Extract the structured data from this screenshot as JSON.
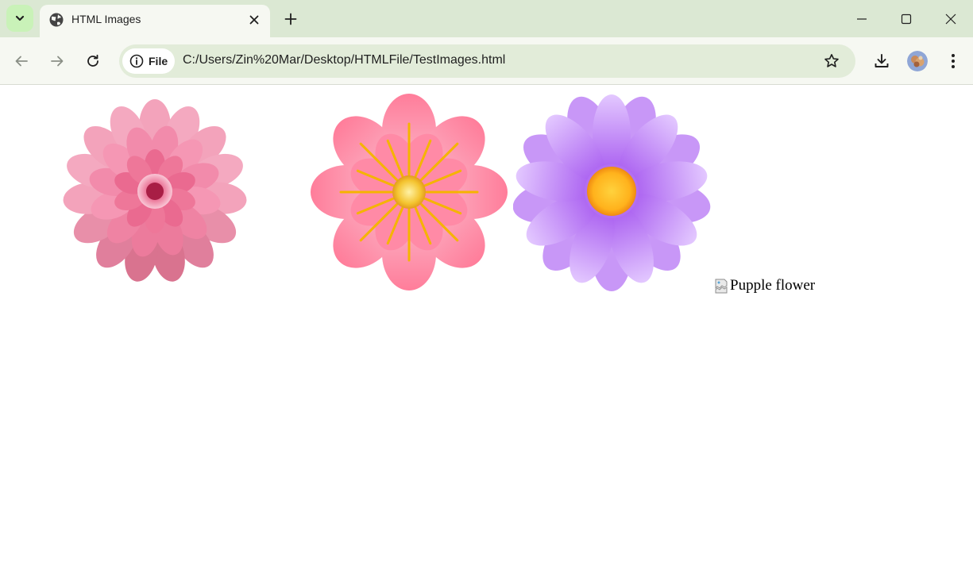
{
  "browser": {
    "tab": {
      "title": "HTML Images"
    },
    "address": {
      "security_chip": "File",
      "url": "C:/Users/Zin%20Mar/Desktop/HTMLFile/TestImages.html"
    }
  },
  "page": {
    "images": [
      {
        "description_icon": "pink-dahlia-flower"
      },
      {
        "description_icon": "pink-cartoon-flower"
      },
      {
        "description_icon": "purple-daisy-flower"
      }
    ],
    "broken_image": {
      "alt": "Pupple flower"
    }
  },
  "colors": {
    "accent": "#dbe8d3",
    "tab_search": "#c9f2b8",
    "omnibox": "#e2ecd9"
  }
}
